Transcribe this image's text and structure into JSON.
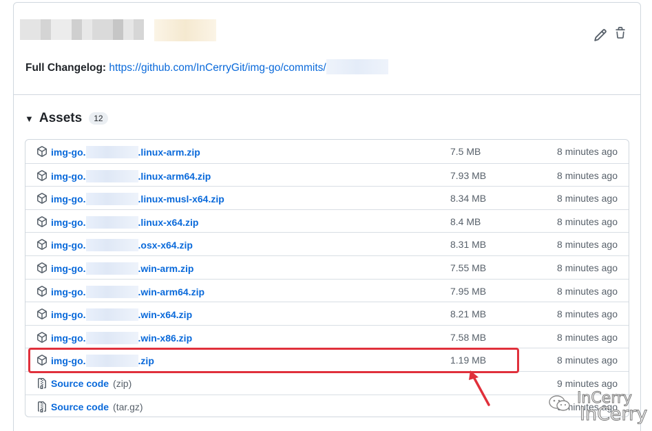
{
  "release": {
    "changelog_label": "Full Changelog:",
    "changelog_link": "https://github.com/InCerryGit/img-go/commits/"
  },
  "assets": {
    "title": "Assets",
    "count": "12",
    "rows": [
      {
        "prefix": "img-go.",
        "suffix": ".linux-arm.zip",
        "size": "7.5 MB",
        "time": "8 minutes ago"
      },
      {
        "prefix": "img-go.",
        "suffix": ".linux-arm64.zip",
        "size": "7.93 MB",
        "time": "8 minutes ago"
      },
      {
        "prefix": "img-go.",
        "suffix": ".linux-musl-x64.zip",
        "size": "8.34 MB",
        "time": "8 minutes ago"
      },
      {
        "prefix": "img-go.",
        "suffix": ".linux-x64.zip",
        "size": "8.4 MB",
        "time": "8 minutes ago"
      },
      {
        "prefix": "img-go.",
        "suffix": ".osx-x64.zip",
        "size": "8.31 MB",
        "time": "8 minutes ago"
      },
      {
        "prefix": "img-go.",
        "suffix": ".win-arm.zip",
        "size": "7.55 MB",
        "time": "8 minutes ago"
      },
      {
        "prefix": "img-go.",
        "suffix": ".win-arm64.zip",
        "size": "7.95 MB",
        "time": "8 minutes ago"
      },
      {
        "prefix": "img-go.",
        "suffix": ".win-x64.zip",
        "size": "8.21 MB",
        "time": "8 minutes ago"
      },
      {
        "prefix": "img-go.",
        "suffix": ".win-x86.zip",
        "size": "7.58 MB",
        "time": "8 minutes ago"
      },
      {
        "prefix": "img-go.",
        "suffix": ".zip",
        "size": "1.19 MB",
        "time": "8 minutes ago"
      }
    ],
    "source_rows": [
      {
        "label": "Source code",
        "ext": "(zip)",
        "time": "9 minutes ago"
      },
      {
        "label": "Source code",
        "ext": "(tar.gz)",
        "time": "9 minutes ago"
      }
    ]
  },
  "icons": {
    "edit": "pencil-icon",
    "delete": "trash-icon",
    "package": "package-icon",
    "file_zip": "file-zip-icon"
  },
  "colors": {
    "link": "#0969da",
    "highlight": "#e0303b",
    "border": "#d0d7de"
  },
  "watermark": {
    "line1": "InCerry",
    "line2": "InCerry"
  }
}
